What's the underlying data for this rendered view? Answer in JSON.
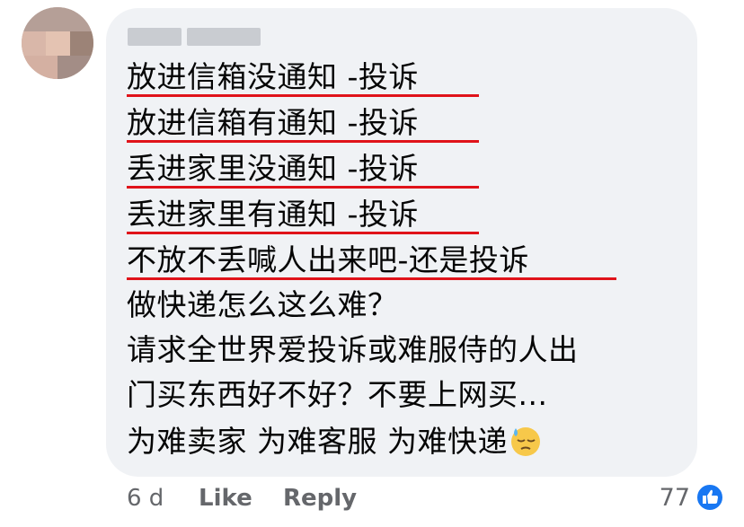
{
  "comment": {
    "author_name": "(blurred)",
    "lines": [
      "放进信箱没通知 -投诉",
      "放进信箱有通知 -投诉",
      "丢进家里没通知 -投诉",
      "丢进家里有通知 -投诉",
      "不放不丢喊人出来吧-还是投诉",
      "做快递怎么这么难？",
      "请求全世界爱投诉或难服侍的人出",
      "门买东西好不好？不要上网买...",
      "为难卖家 为难客服 为难快递"
    ],
    "emoji": "downcast-face-with-sweat",
    "underline_color": "#e0131a"
  },
  "footer": {
    "time": "6 d",
    "like_label": "Like",
    "reply_label": "Reply"
  },
  "reactions": {
    "count": "77",
    "icon": "thumbs-up-icon",
    "accent": "#1877f2"
  }
}
